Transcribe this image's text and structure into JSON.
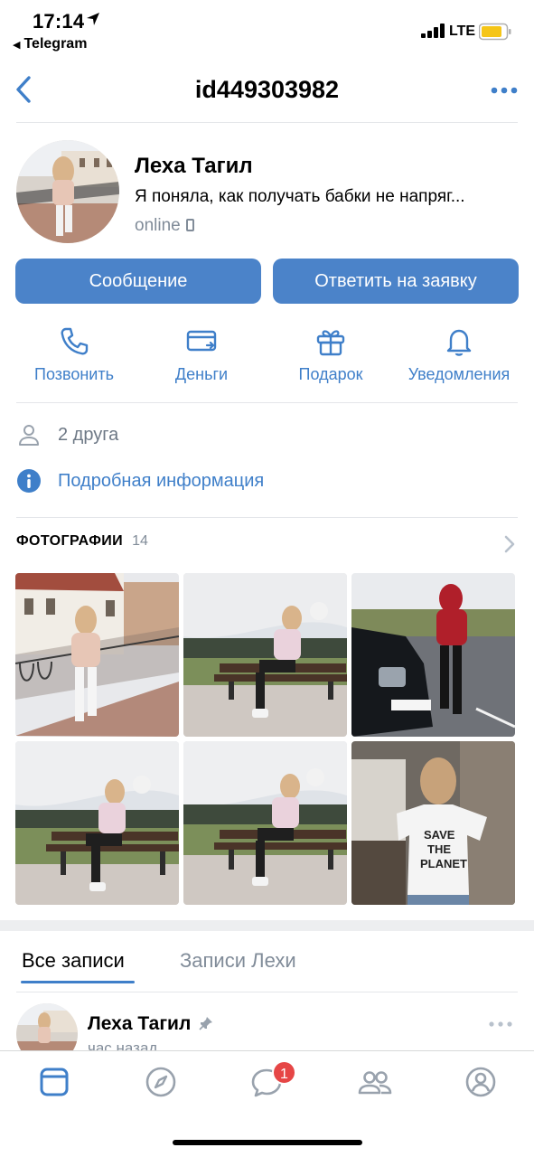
{
  "status_bar": {
    "time": "17:14",
    "back_app": "Telegram",
    "network": "LTE",
    "battery_color": "#f5c518"
  },
  "nav": {
    "title": "id449303982",
    "back_icon": "chevron-left-icon",
    "more_icon": "more-horizontal-icon"
  },
  "profile": {
    "name": "Леха Тагил",
    "status": "Я поняла, как получать бабки не напряг...",
    "online": "online"
  },
  "buttons": {
    "message": "Сообщение",
    "reply": "Ответить на заявку"
  },
  "actions": [
    {
      "label": "Позвонить",
      "icon": "phone-icon"
    },
    {
      "label": "Деньги",
      "icon": "money-transfer-icon"
    },
    {
      "label": "Подарок",
      "icon": "gift-icon"
    },
    {
      "label": "Уведомления",
      "icon": "bell-icon"
    }
  ],
  "info": {
    "friends": "2 друга",
    "details": "Подробная информация"
  },
  "photos": {
    "title": "ФОТОГРАФИИ",
    "count": "14"
  },
  "wall_tabs": {
    "all": "Все записи",
    "own": "Записи Лехи"
  },
  "post": {
    "author": "Леха Тагил",
    "time": "час назад"
  },
  "tabbar": {
    "items": [
      "news-icon",
      "discover-icon",
      "messages-icon",
      "friends-icon",
      "profile-icon"
    ],
    "messages_badge": "1"
  },
  "colors": {
    "accent": "#4b83c9",
    "link": "#3f7fc9",
    "secondary": "#818c99",
    "badge": "#e64646"
  }
}
